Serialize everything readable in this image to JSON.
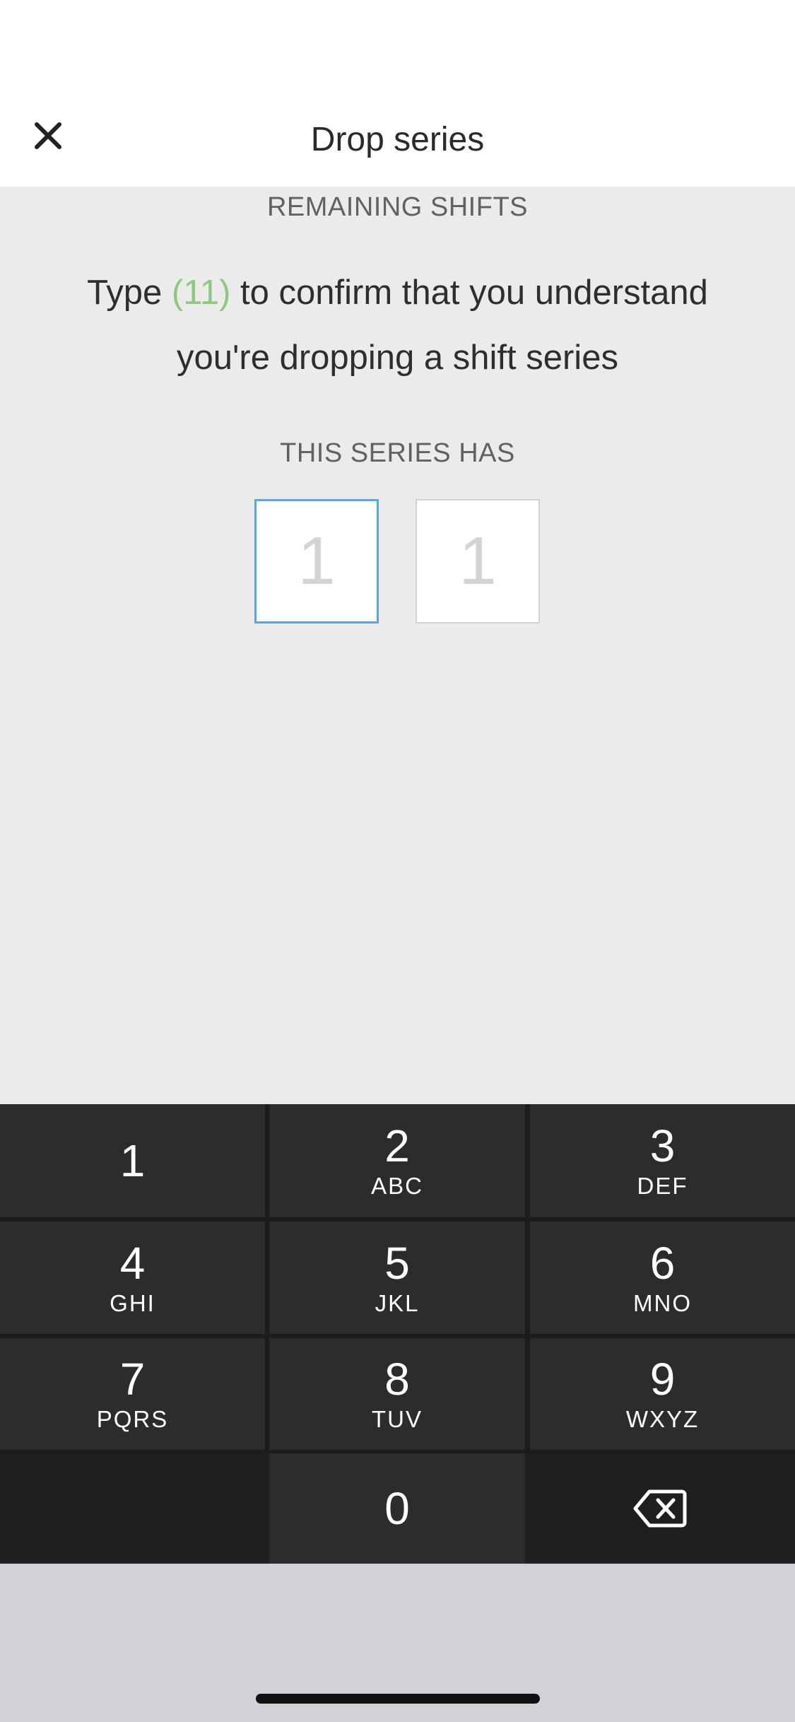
{
  "header": {
    "title": "Drop series",
    "close_icon": "close-icon"
  },
  "content": {
    "remaining_label": "REMAINING SHIFTS",
    "confirm_prefix": "Type ",
    "confirm_code": "(11)",
    "confirm_suffix": " to confirm that you understand you're dropping a shift series",
    "series_has_label": "THIS SERIES HAS",
    "digits": [
      {
        "placeholder": "1",
        "active": true
      },
      {
        "placeholder": "1",
        "active": false
      }
    ]
  },
  "keyboard": {
    "keys": [
      {
        "num": "1",
        "letters": ""
      },
      {
        "num": "2",
        "letters": "ABC"
      },
      {
        "num": "3",
        "letters": "DEF"
      },
      {
        "num": "4",
        "letters": "GHI"
      },
      {
        "num": "5",
        "letters": "JKL"
      },
      {
        "num": "6",
        "letters": "MNO"
      },
      {
        "num": "7",
        "letters": "PQRS"
      },
      {
        "num": "8",
        "letters": "TUV"
      },
      {
        "num": "9",
        "letters": "WXYZ"
      },
      {
        "num": "0",
        "letters": ""
      }
    ],
    "backspace_icon": "backspace-icon"
  },
  "colors": {
    "accent_code": "#8ec77e",
    "active_border": "#5aa7db",
    "background": "#ebebec"
  }
}
